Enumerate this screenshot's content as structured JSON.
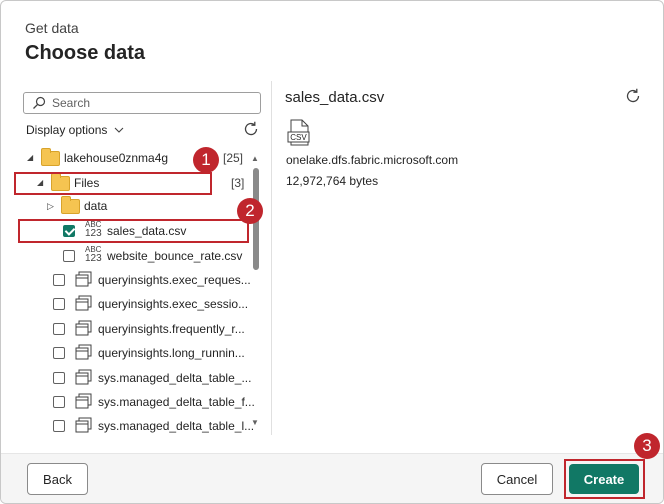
{
  "header": {
    "eyebrow": "Get data",
    "title": "Choose data"
  },
  "search": {
    "placeholder": "Search"
  },
  "display_options": {
    "label": "Display options"
  },
  "tree": {
    "root": {
      "label": "lakehouse0znma4g",
      "count": "[25]"
    },
    "files": {
      "label": "Files",
      "count": "[3]"
    },
    "data_folder": {
      "label": "data"
    },
    "items": [
      {
        "label": "sales_data.csv",
        "type": "file",
        "checked": true
      },
      {
        "label": "website_bounce_rate.csv",
        "type": "file",
        "checked": false
      },
      {
        "label": "queryinsights.exec_reques...",
        "type": "table",
        "checked": false
      },
      {
        "label": "queryinsights.exec_sessio...",
        "type": "table",
        "checked": false
      },
      {
        "label": "queryinsights.frequently_r...",
        "type": "table",
        "checked": false
      },
      {
        "label": "queryinsights.long_runnin...",
        "type": "table",
        "checked": false
      },
      {
        "label": "sys.managed_delta_table_...",
        "type": "table",
        "checked": false
      },
      {
        "label": "sys.managed_delta_table_f...",
        "type": "table",
        "checked": false
      },
      {
        "label": "sys.managed_delta_table_l...",
        "type": "table",
        "checked": false
      }
    ],
    "file_icon_text": {
      "top": "ABC",
      "bottom": "123"
    }
  },
  "preview": {
    "title": "sales_data.csv",
    "file_type": "CSV",
    "source": "onelake.dfs.fabric.microsoft.com",
    "size": "12,972,764 bytes"
  },
  "badges": {
    "one": "1",
    "two": "2",
    "three": "3"
  },
  "footer": {
    "back": "Back",
    "cancel": "Cancel",
    "create": "Create"
  },
  "colors": {
    "accent": "#117865",
    "highlight": "#c0262d",
    "folder": "#f5c451"
  }
}
